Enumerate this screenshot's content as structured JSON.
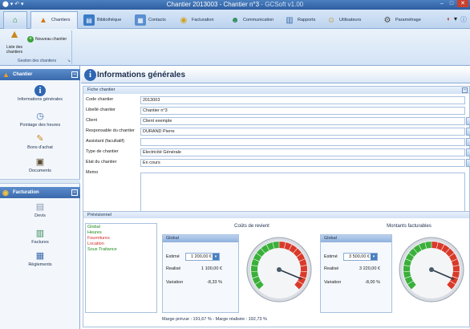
{
  "window": {
    "title": "Chantier 2013003 - Chantier n°3",
    "app_name": "GCSoft v1.00"
  },
  "ribbon_tabs": [
    {
      "label": "Chantiers",
      "icon": "cone-icon",
      "active": true
    },
    {
      "label": "Bibliothèque",
      "icon": "book-icon"
    },
    {
      "label": "Contacts",
      "icon": "contacts-icon"
    },
    {
      "label": "Facturation",
      "icon": "coins-icon"
    },
    {
      "label": "Communication",
      "icon": "people-icon"
    },
    {
      "label": "Rapports",
      "icon": "report-icon"
    },
    {
      "label": "Utilisateurs",
      "icon": "user-icon"
    },
    {
      "label": "Paramétrage",
      "icon": "settings-icon"
    }
  ],
  "ribbon": {
    "list_button": "Liste des chantiers",
    "new_button": "Nouveau chantier",
    "group_label": "Gestion des chantiers"
  },
  "left_panel": {
    "chantier_title": "Chantier",
    "chantier_items": [
      "Informations générales",
      "Pointage des heures",
      "Bons d'achat",
      "Documents"
    ],
    "facturation_title": "Facturation",
    "facturation_items": [
      "Devis",
      "Factures",
      "Règlements"
    ]
  },
  "main": {
    "title": "Informations générales",
    "fiche_title": "Fiche chantier",
    "fields": [
      {
        "label": "Code chantier",
        "value": "2013003",
        "dropdown": false
      },
      {
        "label": "Libellé chantier",
        "value": "Chantier n°3",
        "dropdown": false
      },
      {
        "label": "Client",
        "value": "Client exemple",
        "dropdown": true
      },
      {
        "label": "Responsable du chantier",
        "value": "DURAND Pierre",
        "dropdown": true
      },
      {
        "label": "Assistant (facultatif)",
        "value": "",
        "dropdown": true
      },
      {
        "label": "Type de chantier",
        "value": "Electricité Générale",
        "dropdown": true
      },
      {
        "label": "Etat du chantier",
        "value": "En cours",
        "dropdown": true
      }
    ],
    "memo_label": "Memo"
  },
  "previsionnel": {
    "title": "Prévisionnel",
    "legend": [
      {
        "label": "Global",
        "color": "#1f8a1f"
      },
      {
        "label": "Heures",
        "color": "#1f8a1f"
      },
      {
        "label": "Fournitures",
        "color": "#d42a2a"
      },
      {
        "label": "Location",
        "color": "#d42a2a"
      },
      {
        "label": "Sous Traitance",
        "color": "#1f8a1f"
      }
    ],
    "couts": {
      "title": "Coûts de revient",
      "group": "Global",
      "estime_label": "Estimé",
      "estime_value": "1 200,00 €",
      "realise_label": "Realisé",
      "realise_value": "1 100,00 €",
      "variation_label": "Variation",
      "variation_value": "-8,33 %",
      "gauge_value": 91.67
    },
    "montants": {
      "title": "Montants facturables",
      "group": "Global",
      "estime_label": "Estimé",
      "estime_value": "3 500,00 €",
      "realise_label": "Realisé",
      "realise_value": "3 220,00 €",
      "variation_label": "Variation",
      "variation_value": "-8,00 %",
      "gauge_value": 92.0
    },
    "marge_note": "Marge prévue : 191,67 % - Marge réalisée : 192,73 %"
  },
  "colors": {
    "accent": "#3a6aab",
    "gauge_green": "#3ab03a",
    "gauge_red": "#d93a2a"
  }
}
